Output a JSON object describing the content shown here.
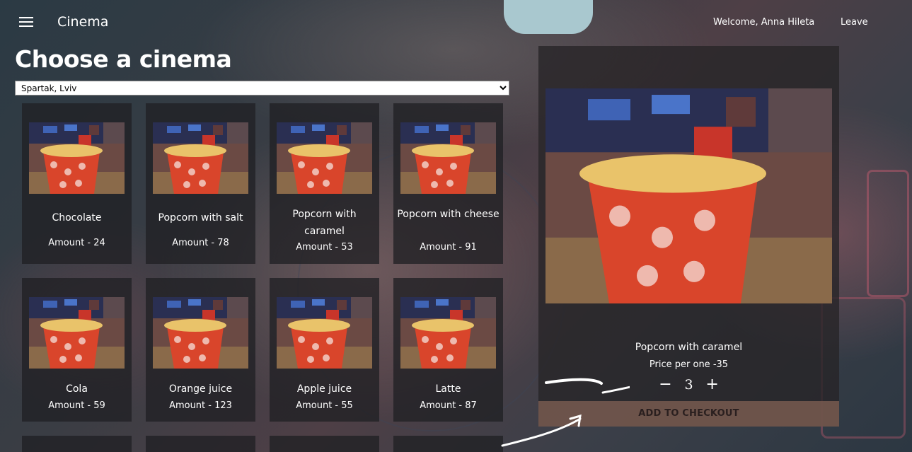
{
  "header": {
    "app_title": "Cinema",
    "welcome": "Welcome, Anna Hileta",
    "leave": "Leave"
  },
  "page": {
    "title": "Choose a cinema",
    "selected_cinema": "Spartak, Lviv"
  },
  "products": [
    {
      "name": "Chocolate",
      "amount": "Amount - 24"
    },
    {
      "name": "Popcorn with salt",
      "amount": "Amount - 78"
    },
    {
      "name": "Popcorn with caramel",
      "amount": "Amount - 53"
    },
    {
      "name": "Popcorn with cheese",
      "amount": "Amount - 91"
    },
    {
      "name": "Cola",
      "amount": "Amount - 59"
    },
    {
      "name": "Orange juice",
      "amount": "Amount - 123"
    },
    {
      "name": "Apple juice",
      "amount": "Amount - 55"
    },
    {
      "name": "Latte",
      "amount": "Amount - 87"
    }
  ],
  "detail": {
    "name": "Popcorn with caramel",
    "price": "Price per one -35",
    "minus": "−",
    "quantity": "3",
    "plus": "+",
    "add_button": "ADD TO CHECKOUT"
  },
  "colors": {
    "popcorn_bucket": "#d9452b",
    "checkout_button": "#785a50"
  }
}
